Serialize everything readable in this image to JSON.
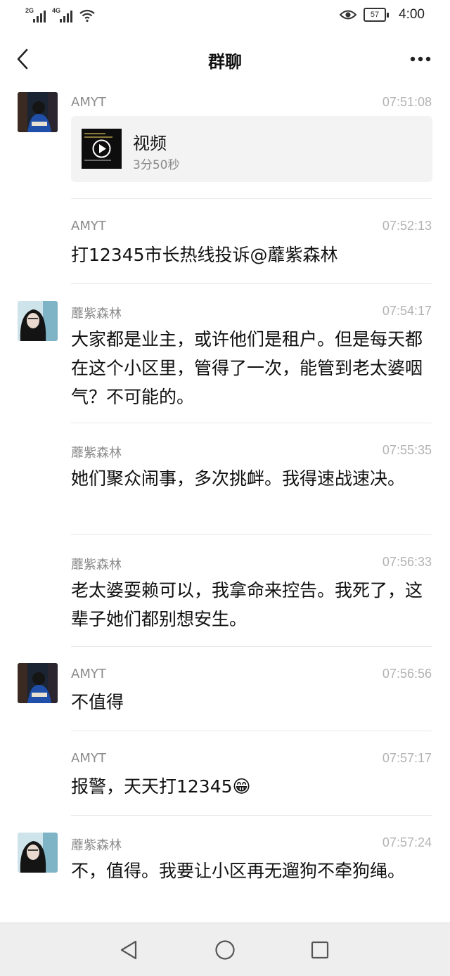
{
  "status_bar": {
    "sim1": "2G",
    "sim2": "4G",
    "battery": "57",
    "time": "4:00"
  },
  "header": {
    "title": "群聊"
  },
  "messages": [
    {
      "sender": "AMYT",
      "time": "07:51:08",
      "video_label": "视频",
      "video_duration": "3分50秒"
    },
    {
      "sender": "AMYT",
      "time": "07:52:13",
      "text": "打12345市长热线投诉@蘼紫森林"
    },
    {
      "sender": "蘼紫森林",
      "time": "07:54:17",
      "text": "大家都是业主，或许他们是租户。但是每天都在这个小区里，管得了一次，能管到老太婆咽气？不可能的。"
    },
    {
      "sender": "蘼紫森林",
      "time": "07:55:35",
      "text": "她们聚众闹事，多次挑衅。我得速战速决。"
    },
    {
      "sender": "蘼紫森林",
      "time": "07:56:33",
      "text": "老太婆耍赖可以，我拿命来控告。我死了，这辈子她们都别想安生。"
    },
    {
      "sender": "AMYT",
      "time": "07:56:56",
      "text": "不值得"
    },
    {
      "sender": "AMYT",
      "time": "07:57:17",
      "text": "报警，天天打12345😁"
    },
    {
      "sender": "蘼紫森林",
      "time": "07:57:24",
      "text": "不，值得。我要让小区再无遛狗不牵狗绳。"
    }
  ],
  "colors": {
    "timestamp": "#b3b3b3",
    "sender": "#8a8a8a",
    "card_bg": "#f3f3f3",
    "nav_bg": "#eeeeee"
  },
  "icons": [
    "back-arrow-icon",
    "more-options-icon",
    "eye-icon",
    "wifi-icon",
    "play-icon",
    "nav-back-icon",
    "nav-home-icon",
    "nav-recents-icon"
  ]
}
